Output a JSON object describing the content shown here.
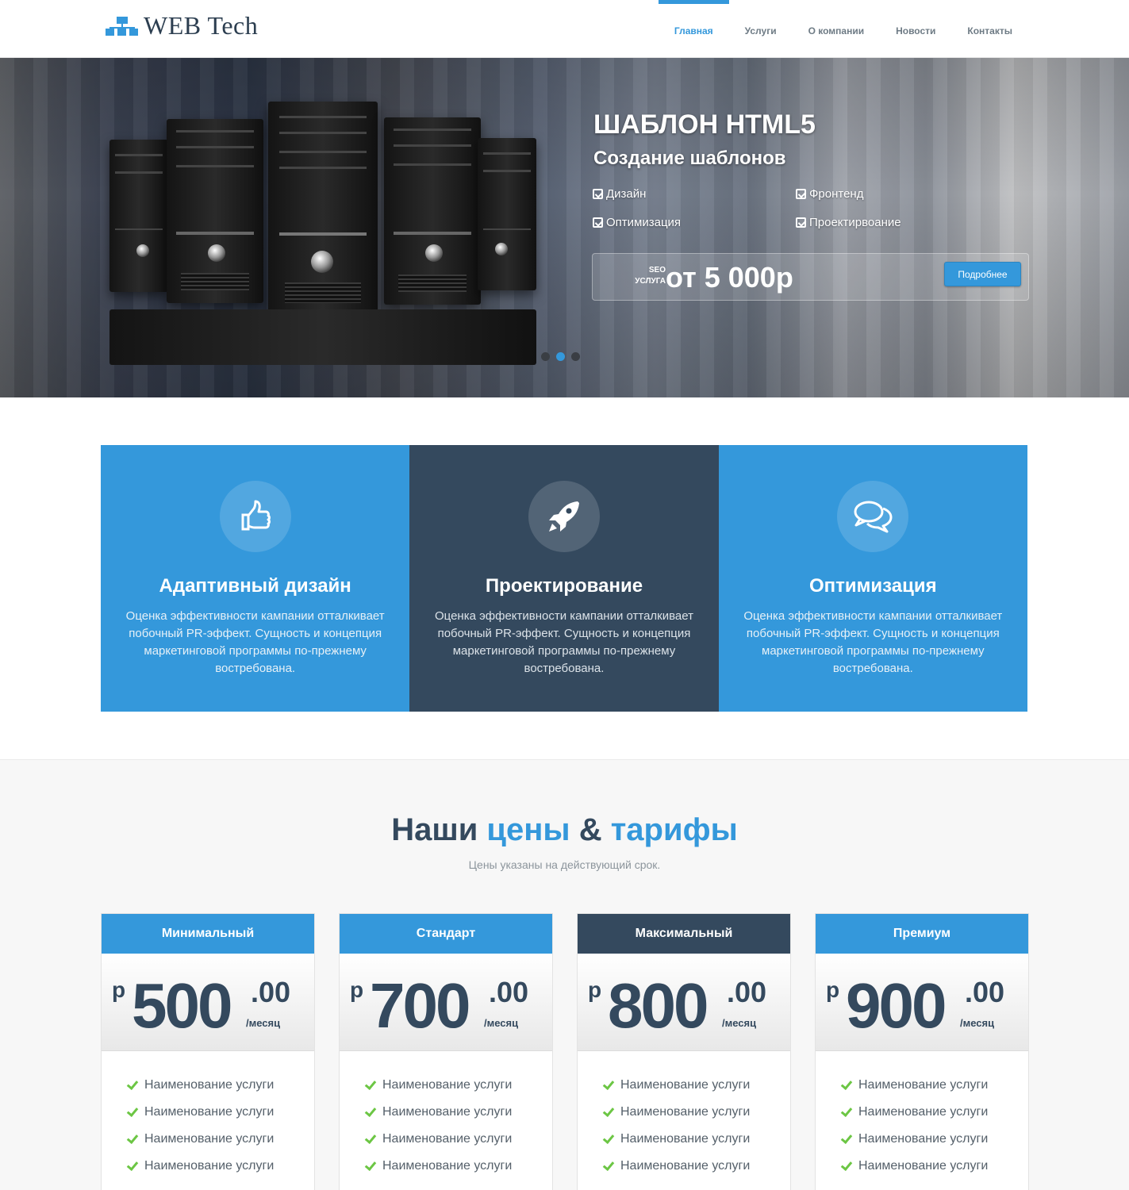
{
  "header": {
    "logo_text": "WEB Tech",
    "nav": [
      "Главная",
      "Услуги",
      "О компании",
      "Новости",
      "Контакты"
    ],
    "active_nav": "Главная"
  },
  "hero": {
    "title": "ШАБЛОН HTML5",
    "subtitle": "Создание шаблонов",
    "features": [
      "Дизайн",
      "Фронтенд",
      "Оптимизация",
      "Проектирвоание"
    ],
    "price_tag_line1": "SEO",
    "price_tag_line2": "УСЛУГА",
    "price": "от 5 000р",
    "button": "Подробнее",
    "slides_count": 3,
    "active_slide": 2
  },
  "features": [
    {
      "icon": "thumbs-up-icon",
      "title": "Адаптивный дизайн",
      "text": "Оценка эффективности кампании отталкивает побочный PR-эффект. Сущность и концепция маркетинговой программы по-прежнему востребована."
    },
    {
      "icon": "rocket-icon",
      "title": "Проектирование",
      "text": "Оценка эффективности кампании отталкивает побочный PR-эффект. Сущность и концепция маркетинговой программы по-прежнему востребована."
    },
    {
      "icon": "chat-bubbles-icon",
      "title": "Оптимизация",
      "text": "Оценка эффективности кампании отталкивает побочный PR-эффект. Сущность и концепция маркетинговой программы по-прежнему востребована."
    }
  ],
  "pricing": {
    "title_part1": "Наши",
    "title_part2": "цены",
    "title_part3": "&",
    "title_part4": "тарифы",
    "subtitle": "Цены указаны на действующий срок.",
    "plans": [
      {
        "name": "Минимальный",
        "currency": "р",
        "amount": "500",
        "cents": ".00",
        "period": "/месяц",
        "items": [
          "Наименование услуги",
          "Наименование услуги",
          "Наименование услуги",
          "Наименование услуги"
        ]
      },
      {
        "name": "Стандарт",
        "currency": "р",
        "amount": "700",
        "cents": ".00",
        "period": "/месяц",
        "items": [
          "Наименование услуги",
          "Наименование услуги",
          "Наименование услуги",
          "Наименование услуги"
        ]
      },
      {
        "name": "Максимальный",
        "currency": "р",
        "amount": "800",
        "cents": ".00",
        "period": "/месяц",
        "items": [
          "Наименование услуги",
          "Наименование услуги",
          "Наименование услуги",
          "Наименование услуги"
        ]
      },
      {
        "name": "Премиум",
        "currency": "р",
        "amount": "900",
        "cents": ".00",
        "period": "/месяц",
        "items": [
          "Наименование услуги",
          "Наименование услуги",
          "Наименование услуги",
          "Наименование услуги"
        ]
      }
    ]
  },
  "colors": {
    "accent": "#3498db",
    "dark": "#34495e",
    "check": "#6cc644"
  }
}
